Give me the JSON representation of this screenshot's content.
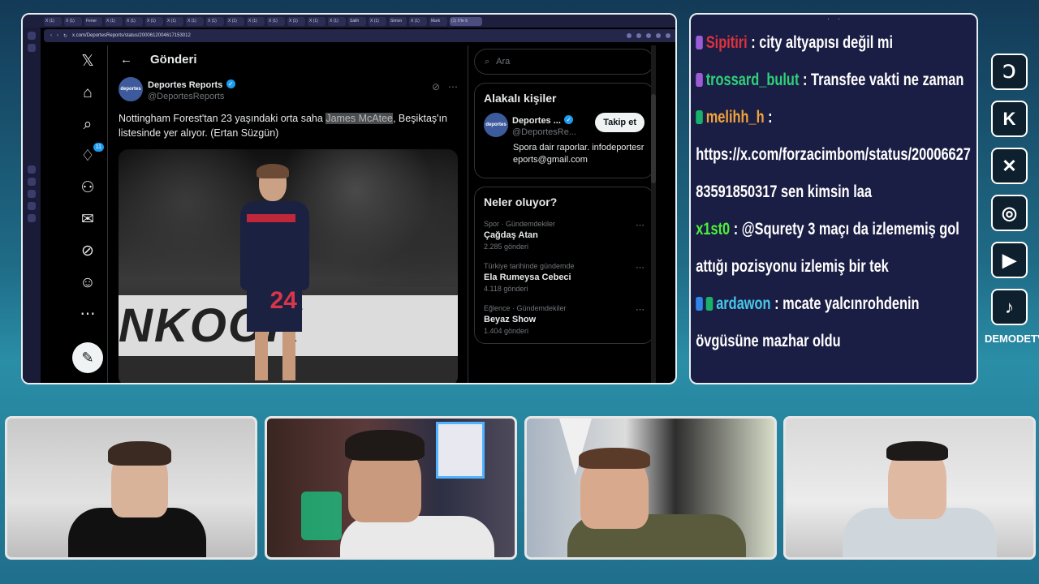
{
  "browser": {
    "tabs": [
      "X (1)",
      "X (1)",
      "Fener",
      "X (1)",
      "X (1)",
      "X (1)",
      "X (1)",
      "X (1)",
      "X (1)",
      "X (1)",
      "X (1)",
      "X (1)",
      "X (1)",
      "X (1)",
      "X (1)",
      "Salih",
      "X (1)",
      "Simon",
      "X (1)",
      "Mark",
      "(1) X'te b"
    ],
    "url": "x.com/DeportesReports/status/2000612004617153012"
  },
  "nav": {
    "notification_count": "11"
  },
  "post": {
    "header_title": "Gönderi",
    "author_name": "Deportes Reports",
    "author_handle": "@DeportesReports",
    "avatar_text": "deportes",
    "text_before": "Nottingham Forest'tan 23 yaşındaki orta saha ",
    "text_highlight": "James McAtee",
    "text_after": ", Beşiktaş'ın listesinde yer alıyor. (Ertan Süzgün)",
    "board_text": "NKOOK",
    "shirt_number": "24"
  },
  "sidebar": {
    "search_placeholder": "Ara",
    "related_title": "Alakalı kişiler",
    "related_name": "Deportes ...",
    "related_handle": "@DeportesRe...",
    "follow_label": "Takip et",
    "related_bio": "Spora dair raporlar. infodeportesreports@gmail.com",
    "trends_title": "Neler oluyor?",
    "trends": [
      {
        "meta": "Spor · Gündemdekiler",
        "name": "Çağdaş Atan",
        "count": "2.285 gönderi"
      },
      {
        "meta": "Türkiye tarihinde gündemde",
        "name": "Ela Rumeysa Cebeci",
        "count": "4.118 gönderi"
      },
      {
        "meta": "Eğlence · Gündemdekiler",
        "name": "Beyaz Show",
        "count": "1.404 gönderi"
      }
    ]
  },
  "chat": {
    "messages": [
      {
        "user": "Sipitiri",
        "text": ": city altyapısı değil mi",
        "color": "#e0323c"
      },
      {
        "user": "trossard_bulut",
        "text": ": Transfee vakti ne zaman",
        "color": "#2fd17a"
      },
      {
        "user": "melihh_h",
        "text": ":",
        "color": "#f2a33a"
      },
      {
        "user": "",
        "text": "https://x.com/forzacimbom/status/2000662783591850317 sen kimsin laa",
        "color": "#ffffff"
      },
      {
        "user": "x1st0",
        "text": ": @Squrety 3 maçı da izlememiş gol attığı pozisyonu izlemiş bir tek",
        "color": "#4cf03a"
      },
      {
        "user": "ardawon",
        "text": ": mcate yalcınrohdenin övgüsüne mazhar oldu",
        "color": "#48c8e8"
      }
    ]
  },
  "socials": {
    "label": "DEMODETV",
    "icons": [
      "kick-d-icon",
      "kick-icon",
      "x-icon",
      "instagram-icon",
      "youtube-icon",
      "tiktok-icon"
    ]
  }
}
